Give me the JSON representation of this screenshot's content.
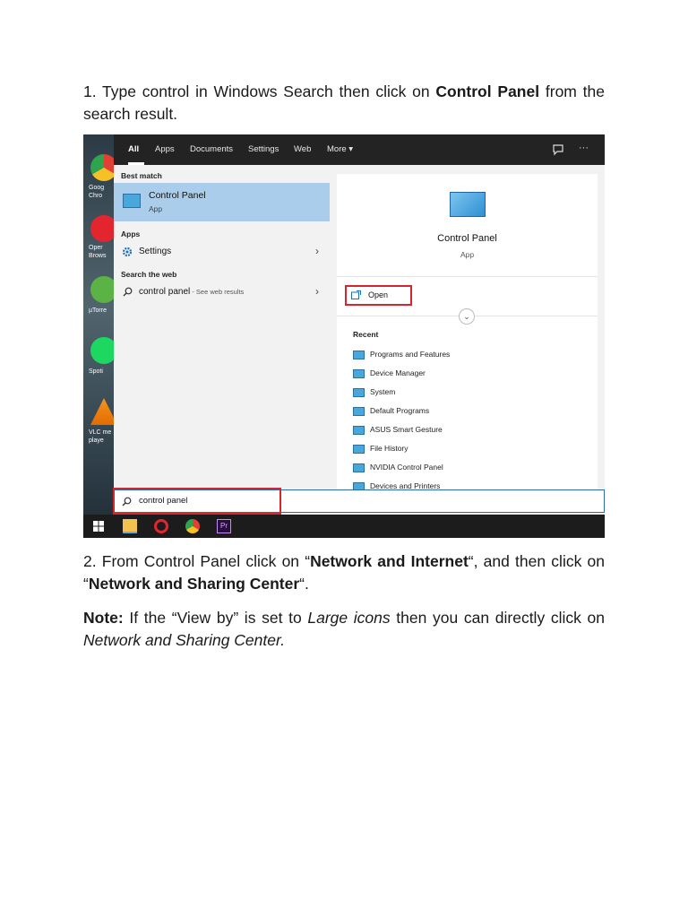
{
  "step1": {
    "prefix": "1. Type control in Windows Search then click on ",
    "bold": "Control Panel",
    "suffix": " from the search result."
  },
  "step2": {
    "prefix": "2. From Control Panel click on  “",
    "bold1": "Network and Internet",
    "mid": "“, and then click on “",
    "bold2": "Network and Sharing Center",
    "suffix": "“."
  },
  "note": {
    "label": "Note:",
    "t1": " If the “View by” is set to ",
    "italic1": "Large icons",
    "t2": " then you can directly click on ",
    "italic2": "Network and Sharing Center."
  },
  "screenshot": {
    "tabs": [
      "All",
      "Apps",
      "Documents",
      "Settings",
      "Web",
      "More ▾"
    ],
    "topright_icons": [
      "feedback-icon",
      "more-icon"
    ],
    "topright_more": "···",
    "desktop_icons": [
      {
        "name": "chrome",
        "label": "Goog Chro"
      },
      {
        "name": "opera",
        "label": "Oper Brows"
      },
      {
        "name": "utorrent",
        "label": "µTorre"
      },
      {
        "name": "spotify",
        "label": "Spoti"
      },
      {
        "name": "vlc",
        "label": "VLC me playe"
      }
    ],
    "left": {
      "best_match_header": "Best match",
      "best_title": "Control Panel",
      "best_sub": "App",
      "apps_header": "Apps",
      "settings_label": "Settings",
      "web_header": "Search the web",
      "web_query": "control panel",
      "web_suffix": " - See web results"
    },
    "right": {
      "title": "Control Panel",
      "sub": "App",
      "open": "Open",
      "recent_header": "Recent",
      "recent_items": [
        "Programs and Features",
        "Device Manager",
        "System",
        "Default Programs",
        "ASUS Smart Gesture",
        "File History",
        "NVIDIA Control Panel",
        "Devices and Printers"
      ]
    },
    "search_value": "control panel",
    "taskbar": [
      "windows-icon",
      "file-explorer-icon",
      "opera-icon",
      "chrome-icon",
      "premiere-icon"
    ],
    "premiere_text": "Pr",
    "colors": {
      "highlight": "#a9cdea",
      "callout": "#d3262e",
      "accent": "#2a6ab0"
    }
  }
}
